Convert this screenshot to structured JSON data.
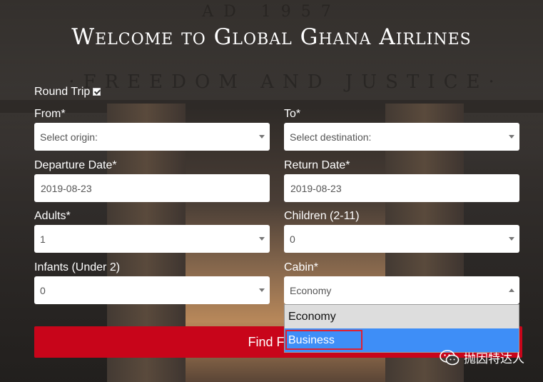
{
  "background": {
    "inscription_top": "AD 1957",
    "inscription_mid": "·FREEDOM AND JUSTICE·"
  },
  "title": "Welcome to Global Ghana Airlines",
  "round_trip": {
    "label": "Round Trip",
    "checked": true
  },
  "from": {
    "label": "From*",
    "value": "Select origin:"
  },
  "to": {
    "label": "To*",
    "value": "Select destination:"
  },
  "departure": {
    "label": "Departure Date*",
    "value": "2019-08-23"
  },
  "return": {
    "label": "Return Date*",
    "value": "2019-08-23"
  },
  "adults": {
    "label": "Adults*",
    "value": "1"
  },
  "children": {
    "label": "Children (2-11)",
    "value": "0"
  },
  "infants": {
    "label": "Infants (Under 2)",
    "value": "0"
  },
  "cabin": {
    "label": "Cabin*",
    "value": "Economy",
    "options": [
      "Economy",
      "Business"
    ],
    "highlighted": "Business"
  },
  "find_button": "Find Fl",
  "watermark": "抛因特达人",
  "colors": {
    "button": "#c8051a",
    "highlight": "#3e8ef7",
    "annotation_box": "#e02030"
  }
}
